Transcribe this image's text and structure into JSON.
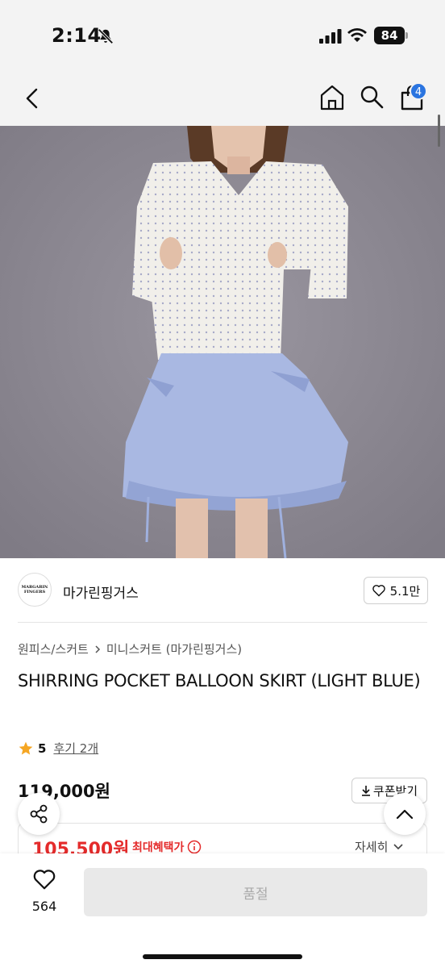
{
  "status_bar": {
    "time": "2:14",
    "battery": "84",
    "icons": [
      "bell-slash-icon",
      "cellular-signal-icon",
      "wifi-icon",
      "battery-icon"
    ]
  },
  "nav": {
    "icons": [
      "back-chevron-icon",
      "home-icon",
      "search-icon",
      "shopping-bag-icon"
    ],
    "cart_badge": "4"
  },
  "product_image": {
    "description_icon": "expand-icon"
  },
  "brand": {
    "logo_text": "MARGARIN FINGERS",
    "name": "마가린핑거스",
    "likes": "5.1만"
  },
  "breadcrumb": {
    "category": "원피스/스커트",
    "subcategory": "미니스커트 (마가린핑거스)"
  },
  "product": {
    "title": "SHIRRING POCKET BALLOON SKIRT (LIGHT BLUE)",
    "rating": "5",
    "reviews": "후기 2개",
    "original_price": "119,000원",
    "coupon_label": "쿠폰받기",
    "sale_price": "105,500원",
    "benefit_label": "최대혜택가",
    "detail_label": "자세히"
  },
  "bottom_bar": {
    "like_count": "564",
    "buy_label": "품절"
  },
  "colors": {
    "accent_blue": "#2a74e0",
    "sale_red": "#e42b2b",
    "star": "#f5a623",
    "image_bg": "#8e8a93"
  }
}
